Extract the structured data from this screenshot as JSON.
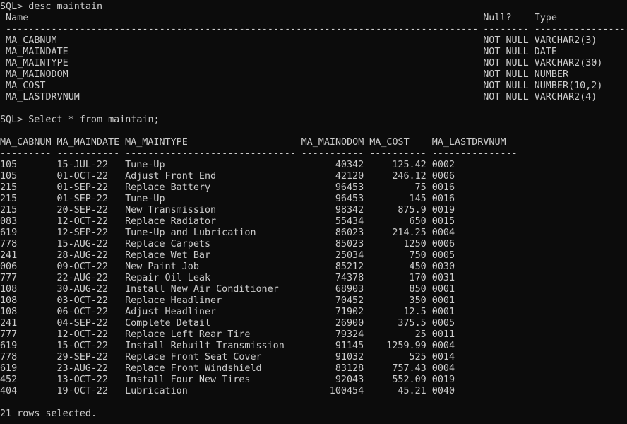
{
  "prompt": "SQL> ",
  "describe": {
    "command": "desc maintain",
    "headers": {
      "name": "Name",
      "null": "Null?",
      "type": "Type"
    },
    "separator_name": "-----------------------------------------------------------------------------------",
    "separator_null": "--------",
    "separator_type": "------------------------------------",
    "rows": [
      {
        "name": "MA_CABNUM",
        "null": "NOT NULL",
        "type": "VARCHAR2(3)"
      },
      {
        "name": "MA_MAINDATE",
        "null": "NOT NULL",
        "type": "DATE"
      },
      {
        "name": "MA_MAINTYPE",
        "null": "NOT NULL",
        "type": "VARCHAR2(30)"
      },
      {
        "name": "MA_MAINODOM",
        "null": "NOT NULL",
        "type": "NUMBER"
      },
      {
        "name": "MA_COST",
        "null": "NOT NULL",
        "type": "NUMBER(10,2)"
      },
      {
        "name": "MA_LASTDRVNUM",
        "null": "NOT NULL",
        "type": "VARCHAR2(4)"
      }
    ]
  },
  "query": {
    "command": "Select * from maintain;",
    "headers": [
      "MA_CABNUM",
      "MA_MAINDATE",
      "MA_MAINTYPE",
      "MA_MAINODOM",
      "MA_COST",
      "MA_LASTDRVNUM"
    ],
    "separators": [
      "---------",
      "-----------",
      "------------------------------",
      "-----------",
      "----------",
      "---------------"
    ],
    "rows": [
      [
        "105",
        "15-JUL-22",
        "Tune-Up",
        "40342",
        "125.42",
        "0002"
      ],
      [
        "105",
        "01-OCT-22",
        "Adjust Front End",
        "42120",
        "246.12",
        "0006"
      ],
      [
        "215",
        "01-SEP-22",
        "Replace Battery",
        "96453",
        "75",
        "0016"
      ],
      [
        "215",
        "01-SEP-22",
        "Tune-Up",
        "96453",
        "145",
        "0016"
      ],
      [
        "215",
        "20-SEP-22",
        "New Transmission",
        "98342",
        "875.9",
        "0019"
      ],
      [
        "083",
        "12-OCT-22",
        "Replace Radiator",
        "55434",
        "650",
        "0015"
      ],
      [
        "619",
        "12-SEP-22",
        "Tune-Up and Lubrication",
        "86023",
        "214.25",
        "0004"
      ],
      [
        "778",
        "15-AUG-22",
        "Replace Carpets",
        "85023",
        "1250",
        "0006"
      ],
      [
        "241",
        "28-AUG-22",
        "Replace Wet Bar",
        "25034",
        "750",
        "0005"
      ],
      [
        "006",
        "09-OCT-22",
        "New Paint Job",
        "85212",
        "450",
        "0030"
      ],
      [
        "777",
        "22-AUG-22",
        "Repair Oil Leak",
        "74378",
        "170",
        "0031"
      ],
      [
        "108",
        "30-AUG-22",
        "Install New Air Conditioner",
        "68903",
        "850",
        "0001"
      ],
      [
        "108",
        "03-OCT-22",
        "Replace Headliner",
        "70452",
        "350",
        "0001"
      ],
      [
        "108",
        "06-OCT-22",
        "Adjust Headliner",
        "71902",
        "12.5",
        "0001"
      ],
      [
        "241",
        "04-SEP-22",
        "Complete Detail",
        "26900",
        "375.5",
        "0005"
      ],
      [
        "777",
        "12-OCT-22",
        "Replace Left Rear Tire",
        "79324",
        "25",
        "0011"
      ],
      [
        "619",
        "15-OCT-22",
        "Install Rebuilt Transmission",
        "91145",
        "1259.99",
        "0004"
      ],
      [
        "778",
        "29-SEP-22",
        "Replace Front Seat Cover",
        "91032",
        "525",
        "0014"
      ],
      [
        "619",
        "23-AUG-22",
        "Replace Front Windshield",
        "83128",
        "757.43",
        "0004"
      ],
      [
        "452",
        "13-OCT-22",
        "Install Four New Tires",
        "92043",
        "552.09",
        "0019"
      ],
      [
        "404",
        "19-OCT-22",
        "Lubrication",
        "100454",
        "45.21",
        "0040"
      ]
    ],
    "footer": "21 rows selected."
  }
}
